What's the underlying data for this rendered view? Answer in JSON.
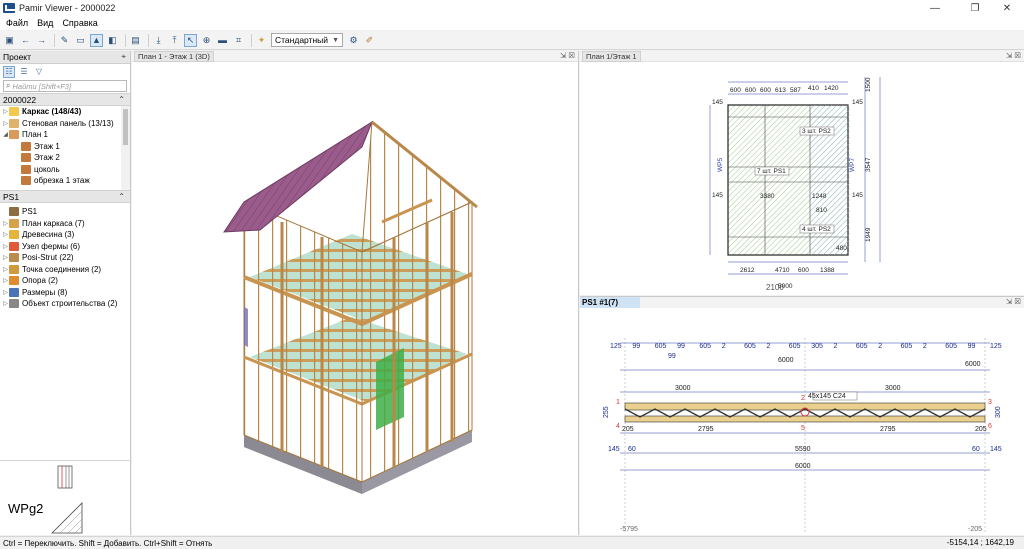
{
  "app": {
    "title": "Pamir Viewer - 2000022",
    "window_controls": {
      "minimize": "—",
      "maximize": "❐",
      "close": "✕"
    }
  },
  "menu": {
    "items": [
      "Файл",
      "Вид",
      "Справка"
    ]
  },
  "toolbar": {
    "view_mode": "Стандартный",
    "icons": [
      "open-icon",
      "back-arrow-icon",
      "forward-arrow-icon",
      "edit-icon",
      "view-icon",
      "image-icon",
      "layers-icon",
      "camera-icon",
      "import-icon",
      "export-icon",
      "cursor-icon",
      "zoom-icon",
      "measure-icon",
      "tree-icon"
    ]
  },
  "left_panel": {
    "project_header": "Проект",
    "search_placeholder": "Найти [Shift+F3]",
    "project_section": "2000022",
    "project_tree": [
      {
        "label": "Каркас (148/43)",
        "bold": true,
        "expand": "▷",
        "color": "#f2c94c"
      },
      {
        "label": "Стеновая панель (13/13)",
        "bold": false,
        "expand": "▷",
        "color": "#e0b36a"
      },
      {
        "label": "План 1",
        "bold": false,
        "expand": "◢",
        "color": "#d99b5b"
      },
      {
        "label": "Этаж 1",
        "bold": false,
        "expand": "",
        "color": "#c2793b",
        "indent": true
      },
      {
        "label": "Этаж 2",
        "bold": false,
        "expand": "",
        "color": "#c2793b",
        "indent": true
      },
      {
        "label": "цоколь",
        "bold": false,
        "expand": "",
        "color": "#c2793b",
        "indent": true
      },
      {
        "label": "обрезка 1 этаж",
        "bold": false,
        "expand": "",
        "color": "#c2793b",
        "indent": true
      }
    ],
    "element_section": "PS1",
    "element_tree": [
      {
        "label": "PS1",
        "expand": "",
        "color": "#8c6d3f"
      },
      {
        "label": "План каркаса (7)",
        "expand": "▷",
        "color": "#d8a24c"
      },
      {
        "label": "Древесина (3)",
        "expand": "▷",
        "color": "#e6b43c"
      },
      {
        "label": "Узел фермы (6)",
        "expand": "▷",
        "color": "#e05a3a"
      },
      {
        "label": "Posi-Strut (22)",
        "expand": "▷",
        "color": "#b88c4a"
      },
      {
        "label": "Точка соединения (2)",
        "expand": "▷",
        "color": "#cf9a3d"
      },
      {
        "label": "Опора (2)",
        "expand": "▷",
        "color": "#e28b2e"
      },
      {
        "label": "Размеры (8)",
        "expand": "▷",
        "color": "#4a73b8"
      },
      {
        "label": "Объект строительства (2)",
        "expand": "▷",
        "color": "#888888"
      }
    ],
    "preview_label": "WPg2"
  },
  "viewports": {
    "view3d_title": "План 1 - Этаж 1 (3D)",
    "plan_title": "План 1/Этаж 1",
    "ps_title": "PS1 #1(7)"
  },
  "plan": {
    "top_dims": [
      "600",
      "600",
      "600",
      "613",
      "587",
      "410",
      "1420"
    ],
    "left_145": "145",
    "right_145": "145",
    "labels": [
      "3 шт. PS2",
      "7 шт. PS1",
      "4 шт. PS2"
    ],
    "dims_inner": [
      "3380",
      "3015",
      "1248",
      "2695",
      "810",
      "1949",
      "480",
      "1370"
    ],
    "vertical_labels": [
      "WP5",
      "WP7",
      "WP4",
      "WP3"
    ],
    "bottom_dims": [
      "2612",
      "4710",
      "600",
      "1388"
    ],
    "total_width": "5000",
    "offset_label": "2100",
    "right_dims": [
      "1500",
      "1713",
      "210",
      "3547",
      "2667",
      "1949"
    ]
  },
  "truss": {
    "top_row": [
      "125",
      "99",
      "605",
      "99",
      "605",
      "2",
      "605",
      "2",
      "605",
      "305",
      "2",
      "605",
      "2",
      "605",
      "2",
      "605",
      "99",
      "125"
    ],
    "top_row2": "99",
    "span_total": "6000",
    "right_small": "6000",
    "half_left": "3000",
    "half_right": "3000",
    "member_label": "45x145 C24",
    "height_left": "255",
    "height_right": "300",
    "bottom_row": [
      "205",
      "2795",
      "2795",
      "205"
    ],
    "overall": [
      "145",
      "60",
      "5590",
      "60",
      "145"
    ],
    "overall_total": "6000",
    "axis_left": "-5795",
    "axis_right": "-205",
    "node_nums": [
      "1",
      "2",
      "3",
      "4",
      "5",
      "6"
    ]
  },
  "status": {
    "hint": "Ctrl = Переключить. Shift = Добавить. Ctrl+Shift = Отнять",
    "coords": "-5154,14 ; 1642,19"
  }
}
